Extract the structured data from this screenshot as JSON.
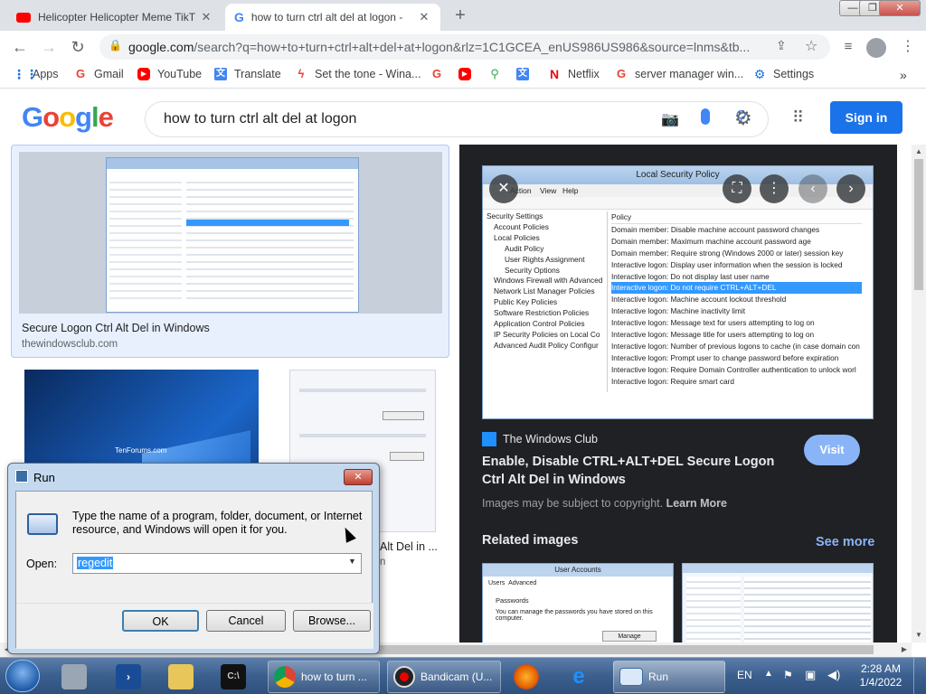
{
  "tabs": [
    {
      "title": "Helicopter Helicopter Meme TikT",
      "close": "✕"
    },
    {
      "title": "how to turn ctrl alt del at logon -",
      "close": "✕"
    }
  ],
  "new_tab": "+",
  "window_controls": {
    "minimize": "—",
    "maximize": "❐",
    "close": "✕"
  },
  "toolbar": {
    "url_host": "google.com",
    "url_path": "/search?q=how+to+turn+ctrl+alt+del+at+logon&rlz=1C1GCEA_enUS986US986&source=lnms&tb..."
  },
  "bookmarks": [
    "Apps",
    "Gmail",
    "YouTube",
    "Translate",
    "Set the tone - Wina...",
    "",
    "",
    "",
    "",
    "Netflix",
    "server manager win...",
    "Settings"
  ],
  "google": {
    "logo": [
      "G",
      "o",
      "o",
      "g",
      "l",
      "e"
    ],
    "logo_colors": [
      "#4285f4",
      "#ea4335",
      "#fbbc05",
      "#4285f4",
      "#34a853",
      "#ea4335"
    ],
    "query": "how to turn ctrl alt del at logon",
    "sign_in": "Sign in"
  },
  "results": {
    "first_caption": "Secure Logon Ctrl Alt Del in Windows",
    "first_source": "thewindowsclub.com",
    "second_thumb_label": "TenForums.com",
    "third_caption": "Alt Del in ...",
    "third_source": "n"
  },
  "panel": {
    "source": "The Windows Club",
    "title": "Enable, Disable CTRL+ALT+DEL Secure Logon Ctrl Alt Del in Windows",
    "visit": "Visit",
    "copyright": "Images may be subject to copyright.",
    "learn_more": "Learn More",
    "related": "Related images",
    "see_more": "See more"
  },
  "lsp": {
    "title": "Local Security Policy",
    "menu": [
      "Action",
      "View",
      "Help"
    ],
    "tree": [
      "Security Settings",
      "Account Policies",
      "Local Policies",
      "Audit Policy",
      "User Rights Assignment",
      "Security Options",
      "Windows Firewall with Advanced",
      "Network List Manager Policies",
      "Public Key Policies",
      "Software Restriction Policies",
      "Application Control Policies",
      "IP Security Policies on Local Co",
      "Advanced Audit Policy Configur"
    ],
    "policy_header": "Policy",
    "policies": [
      "Domain member: Disable machine account password changes",
      "Domain member: Maximum machine account password age",
      "Domain member: Require strong (Windows 2000 or later) session key",
      "Interactive logon: Display user information when the session is locked",
      "Interactive logon: Do not display last user name",
      "Interactive logon: Do not require CTRL+ALT+DEL",
      "Interactive logon: Machine account lockout threshold",
      "Interactive logon: Machine inactivity limit",
      "Interactive logon: Message text for users attempting to log on",
      "Interactive logon: Message title for users attempting to log on",
      "Interactive logon: Number of previous logons to cache (in case domain con",
      "Interactive logon: Prompt user to change password before expiration",
      "Interactive logon: Require Domain Controller authentication to unlock worl",
      "Interactive logon: Require smart card"
    ],
    "selected_index": 5
  },
  "related_thumb": {
    "title": "User Accounts",
    "tabs": [
      "Users",
      "Advanced"
    ],
    "section": "Passwords",
    "text": "You can manage the passwords you have stored on this computer.",
    "button": "Manage Passwords"
  },
  "run": {
    "title": "Run",
    "description": "Type the name of a program, folder, document, or Internet resource, and Windows will open it for you.",
    "open_label": "Open:",
    "value": "regedit",
    "ok": "OK",
    "cancel": "Cancel",
    "browse": "Browse..."
  },
  "taskbar": {
    "chrome": "how to turn ...",
    "bandicam": "Bandicam (U...",
    "run": "Run",
    "lang": "EN",
    "time": "2:28 AM",
    "date": "1/4/2022"
  }
}
